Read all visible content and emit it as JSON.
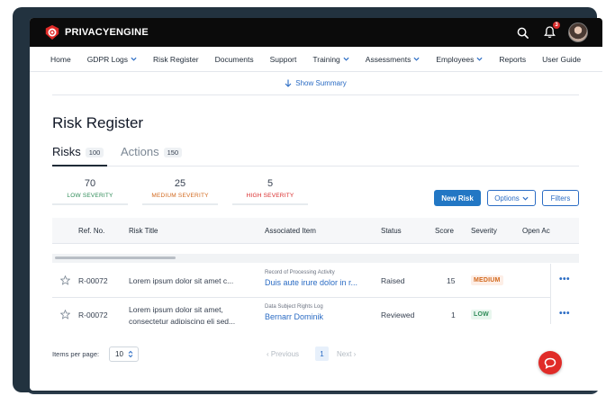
{
  "app": {
    "brand": "PRIVACYENGINE"
  },
  "topbar": {
    "notification_count": "3",
    "icons": [
      "search-icon",
      "bell-icon"
    ]
  },
  "nav": {
    "items": [
      {
        "label": "Home",
        "dropdown": false
      },
      {
        "label": "GDPR Logs",
        "dropdown": true
      },
      {
        "label": "Risk Register",
        "dropdown": false
      },
      {
        "label": "Documents",
        "dropdown": false
      },
      {
        "label": "Support",
        "dropdown": false
      },
      {
        "label": "Training",
        "dropdown": true
      },
      {
        "label": "Assessments",
        "dropdown": true
      },
      {
        "label": "Employees",
        "dropdown": true
      },
      {
        "label": "Reports",
        "dropdown": false
      },
      {
        "label": "User Guide",
        "dropdown": false
      }
    ]
  },
  "summary": {
    "toggle_label": "Show Summary"
  },
  "page": {
    "title": "Risk Register"
  },
  "tabs": [
    {
      "label": "Risks",
      "count": "100",
      "active": true
    },
    {
      "label": "Actions",
      "count": "150",
      "active": false
    }
  ],
  "severity": {
    "low": {
      "count": "70",
      "label": "LOW SEVERITY",
      "color": "#2e8b57"
    },
    "medium": {
      "count": "25",
      "label": "MEDIUM SEVERITY",
      "color": "#d2691e"
    },
    "high": {
      "count": "5",
      "label": "HIGH SEVERITY",
      "color": "#d92b2b"
    }
  },
  "toolbar": {
    "new_label": "New Risk",
    "options_label": "Options",
    "filters_label": "Filters"
  },
  "table": {
    "headers": {
      "ref": "Ref. No.",
      "title": "Risk Title",
      "assoc": "Associated Item",
      "status": "Status",
      "score": "Score",
      "severity": "Severity",
      "open": "Open Ac"
    },
    "rows": [
      {
        "ref": "R-00072",
        "title_line1": "Lorem ipsum dolor sit amet c...",
        "title_line2": "",
        "assoc_type": "Record of Processing Activity",
        "assoc_name": "Duis aute irure dolor in r...",
        "status": "Raised",
        "score": "15",
        "severity": "MEDIUM"
      },
      {
        "ref": "R-00072",
        "title_line1": "Lorem ipsum dolor sit amet,",
        "title_line2": "consectetur adipiscing eli sed...",
        "assoc_type": "Data Subject Rights Log",
        "assoc_name": "Bernarr Dominik",
        "status": "Reviewed",
        "score": "1",
        "severity": "LOW"
      }
    ],
    "row_menu_glyph": "•••"
  },
  "pagination": {
    "items_per_page_label": "Items per page:",
    "items_per_page_value": "10",
    "prev_label": "Previous",
    "current_page": "1",
    "next_label": "Next"
  },
  "colors": {
    "accent": "#2277c4",
    "link": "#2b6cc4",
    "brand_red": "#e02b28"
  }
}
